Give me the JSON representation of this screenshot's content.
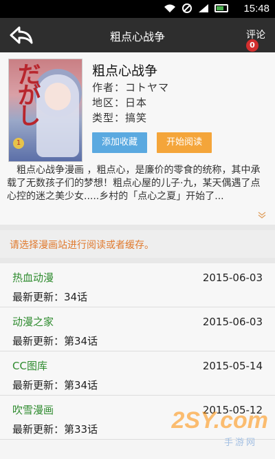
{
  "status_bar": {
    "time": "15:48"
  },
  "title_bar": {
    "title": "粗点心战争",
    "comment_label": "评论",
    "comment_count": "0"
  },
  "manga": {
    "title": "粗点心战争",
    "author": "作者：コトヤマ",
    "region": "地区：日本",
    "type": "类型：搞笑",
    "cover_text": "だがし",
    "cover_volume": "1",
    "description": "　粗点心战争漫画 ，粗点心，是廉价的零食的统称，其中承载了无数孩子们的梦想！粗点心屋的儿子·九，某天偶遇了点心控的迷之美少女.....乡村的「点心之夏」开始了..."
  },
  "actions": {
    "favorite_label": "添加收藏",
    "read_label": "开始阅读"
  },
  "notice": "请选择漫画站进行阅读或者缓存。",
  "sources": [
    {
      "name": "热血动漫",
      "date": "2015-06-03",
      "latest": "最新更新：34话"
    },
    {
      "name": "动漫之家",
      "date": "2015-06-03",
      "latest": "最新更新：第34话"
    },
    {
      "name": "CC图库",
      "date": "2015-05-14",
      "latest": "最新更新：第34话"
    },
    {
      "name": "吹雪漫画",
      "date": "2015-05-12",
      "latest": "最新更新：第33话"
    }
  ],
  "watermark": {
    "main": "2SY.com",
    "sub": "手游网"
  },
  "colors": {
    "accent_blue": "#5aa9e0",
    "accent_orange": "#f4a53a",
    "source_green": "#2e8b2e",
    "notice_orange": "#e07a2e",
    "badge_red": "#d32f2f"
  }
}
